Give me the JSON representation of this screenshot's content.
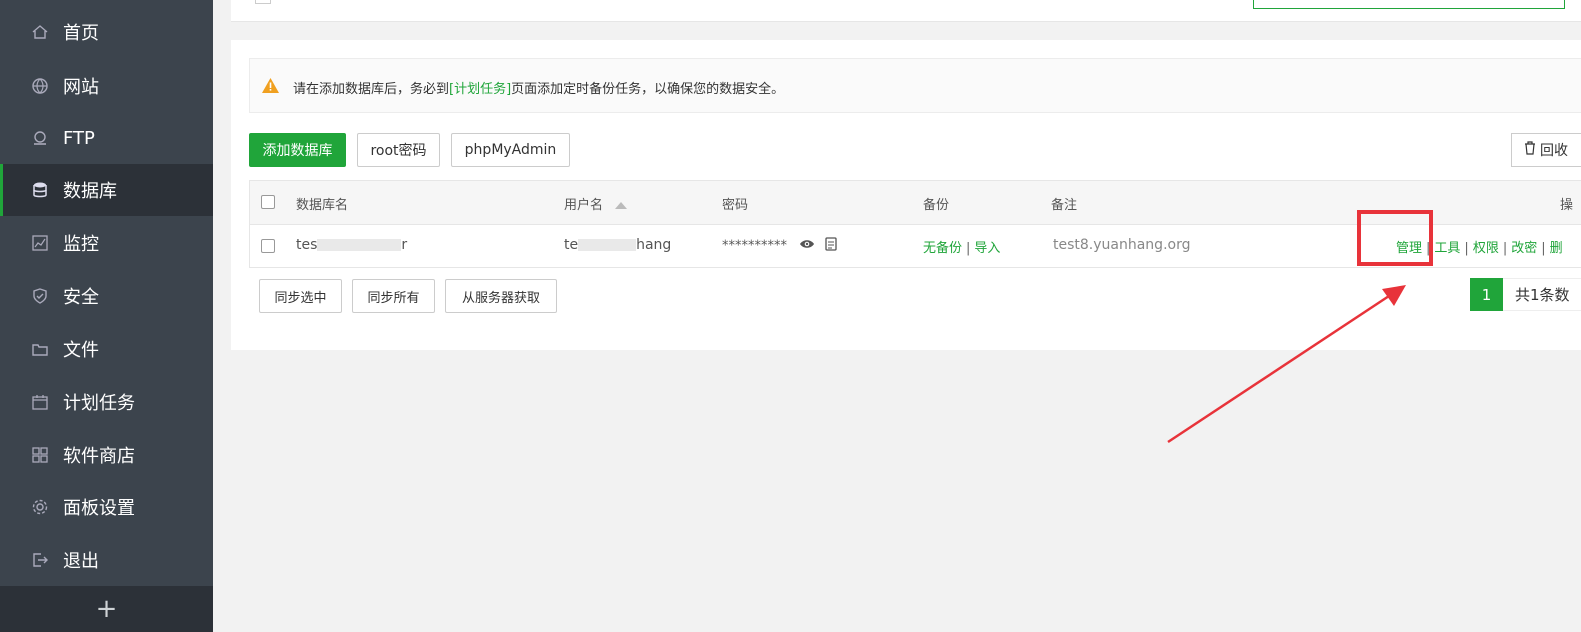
{
  "sidebar": {
    "items": [
      {
        "label": "首页",
        "icon": "home-icon"
      },
      {
        "label": "网站",
        "icon": "globe-icon"
      },
      {
        "label": "FTP",
        "icon": "ftp-icon"
      },
      {
        "label": "数据库",
        "icon": "database-icon",
        "active": true
      },
      {
        "label": "监控",
        "icon": "monitor-icon"
      },
      {
        "label": "安全",
        "icon": "shield-icon"
      },
      {
        "label": "文件",
        "icon": "folder-icon"
      },
      {
        "label": "计划任务",
        "icon": "calendar-icon"
      },
      {
        "label": "软件商店",
        "icon": "grid-icon"
      },
      {
        "label": "面板设置",
        "icon": "gear-icon"
      },
      {
        "label": "退出",
        "icon": "logout-icon"
      }
    ],
    "footer_symbol": "+"
  },
  "notice": {
    "prefix": "请在添加数据库后，务必到",
    "link": "[计划任务]",
    "suffix": "页面添加定时备份任务，以确保您的数据安全。"
  },
  "toolbar": {
    "add_label": "添加数据库",
    "root_label": "root密码",
    "pma_label": "phpMyAdmin",
    "recycle_label": "回收"
  },
  "table": {
    "headers": {
      "name": "数据库名",
      "user": "用户名",
      "password": "密码",
      "backup": "备份",
      "note": "备注",
      "ops": "操"
    },
    "row": {
      "name_prefix": "tes",
      "name_suffix": "r",
      "user_prefix": "te",
      "user_suffix": "hang",
      "password": "**********",
      "backup_none": "无备份",
      "backup_import": "导入",
      "note": "test8.yuanhang.org",
      "actions": [
        "管理",
        "工具",
        "权限",
        "改密",
        "删"
      ]
    }
  },
  "bottom": {
    "sync_selected": "同步选中",
    "sync_all": "同步所有",
    "fetch_server": "从服务器获取"
  },
  "pager": {
    "current": "1",
    "total_text": "共1条数"
  },
  "colors": {
    "accent": "#20a53a",
    "sidebar": "#3c444d",
    "annotation": "#e8333a"
  }
}
